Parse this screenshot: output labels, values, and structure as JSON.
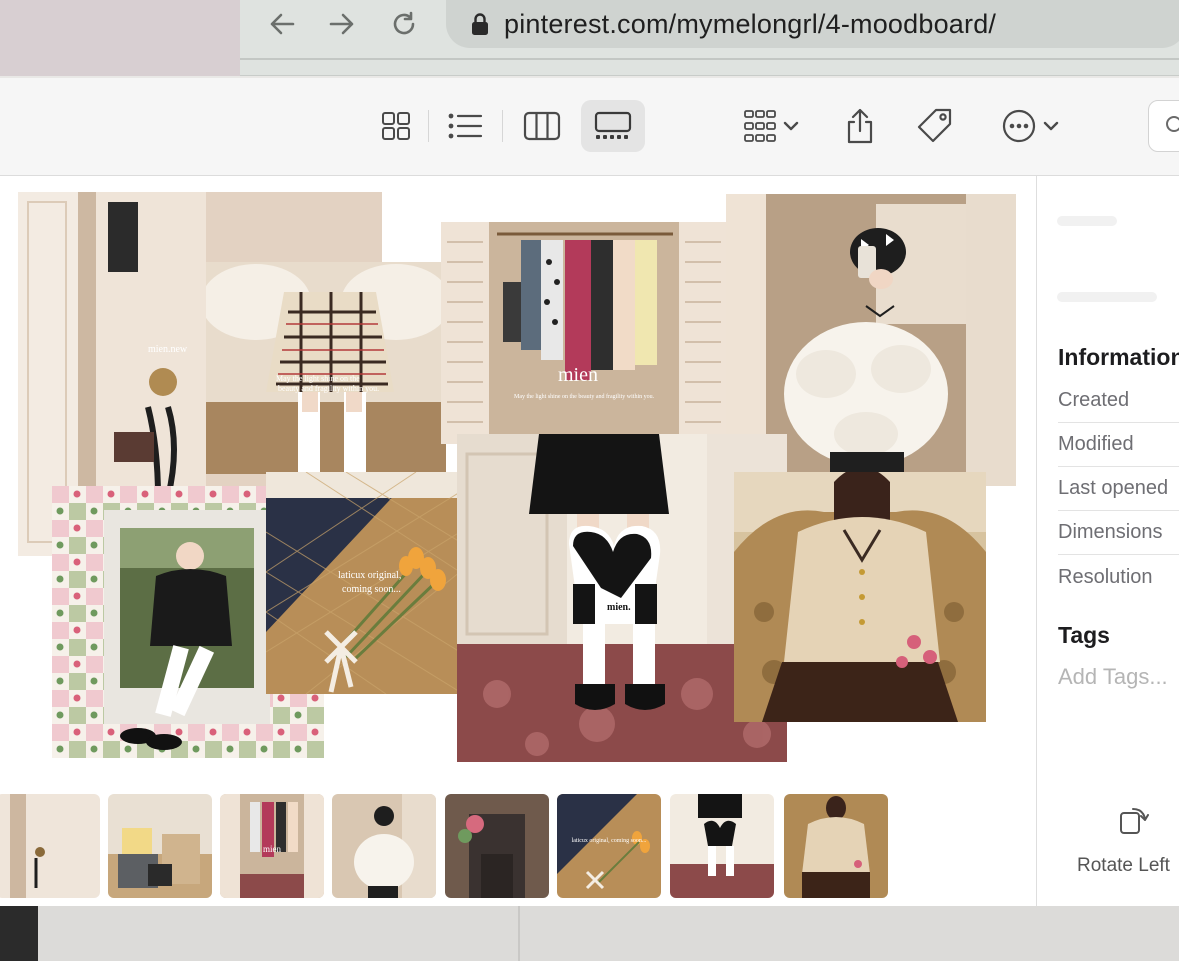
{
  "browser": {
    "url": "pinterest.com/mymelongrl/4-moodboard/"
  },
  "toolbar": {
    "buttons": [
      "grid-view",
      "list-view",
      "column-view",
      "gallery-view",
      "group-by",
      "share",
      "tags",
      "more-actions"
    ]
  },
  "moodboard": {
    "captions": {
      "mien_new": "mien.new",
      "skirt_line1": "May the light shine on the",
      "skirt_line2": "beauty and fragility within you.",
      "closet_brand": "mien",
      "closet_line": "May the light shine on the beauty and fragility within you.",
      "tulip_line1": "laticux original,",
      "tulip_line2": "coming soon...",
      "socks_brand": "mien."
    }
  },
  "filmstrip": {
    "thumb_captions": [
      "",
      "",
      "mien",
      "",
      "",
      "laticux original, coming soon...",
      "",
      ""
    ]
  },
  "inspector": {
    "information_title": "Information",
    "rows": [
      "Created",
      "Modified",
      "Last opened",
      "Dimensions",
      "Resolution"
    ],
    "tags_title": "Tags",
    "tags_placeholder": "Add Tags...",
    "rotate_label": "Rotate Left"
  },
  "colors": {
    "cream_wall": "#ece1d6",
    "wood_door": "#dfcfbf",
    "plaid_bg": "#e8d9c7",
    "carpet_red": "#8a3a3a",
    "tulip_frame_green": "#bcc9a3",
    "tulip_frame_pink": "#f0c9cf",
    "jacket_beige": "#d8c4a6",
    "sofa_gold": "#b08a55"
  }
}
